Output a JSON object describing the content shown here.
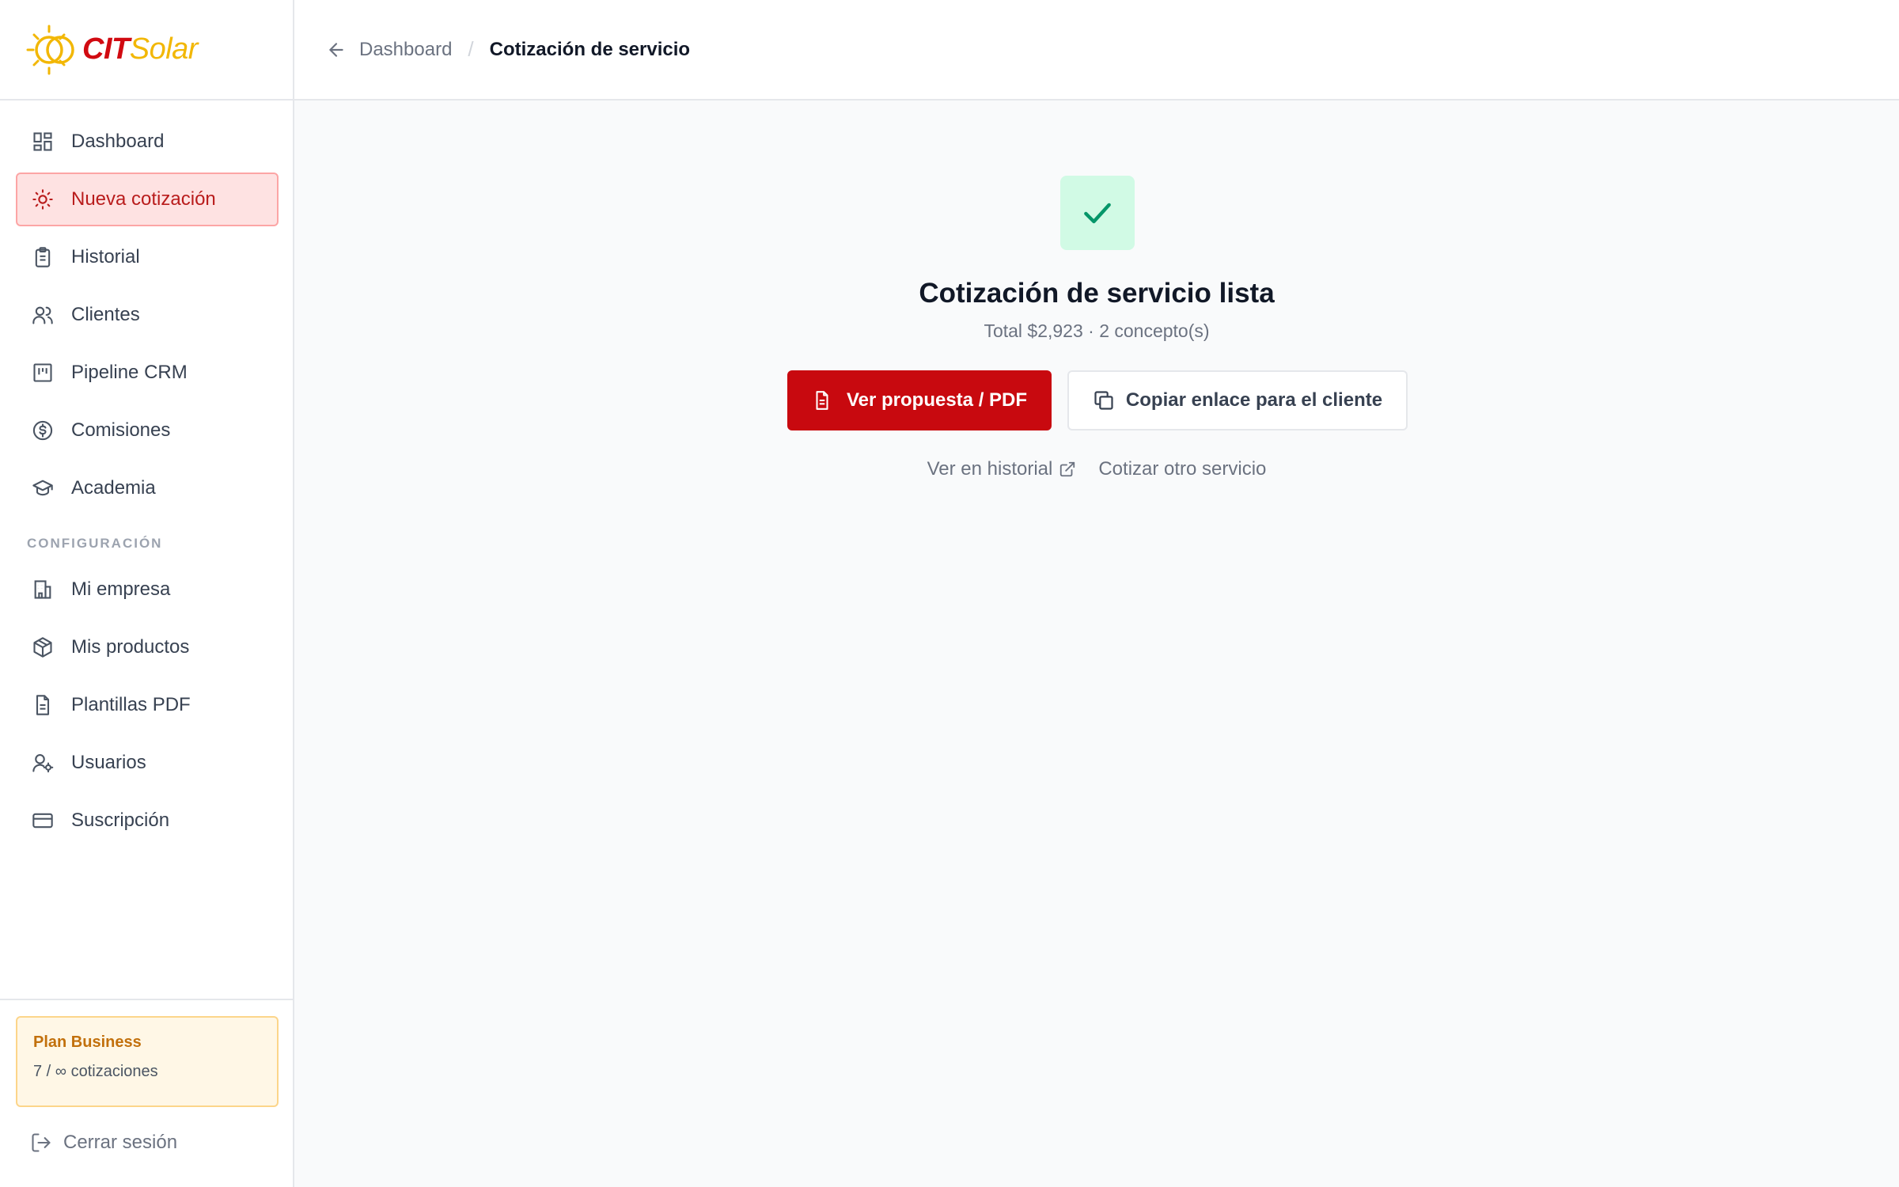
{
  "brand": {
    "part1": "CIT",
    "part2": "Solar",
    "primary_color": "#c8090f",
    "accent_color": "#f2b705"
  },
  "sidebar": {
    "items": [
      {
        "label": "Dashboard",
        "icon": "dashboard-icon"
      },
      {
        "label": "Nueva cotización",
        "icon": "sun-icon",
        "active": true
      },
      {
        "label": "Historial",
        "icon": "clipboard-icon"
      },
      {
        "label": "Clientes",
        "icon": "users-icon"
      },
      {
        "label": "Pipeline CRM",
        "icon": "kanban-icon"
      },
      {
        "label": "Comisiones",
        "icon": "dollar-circle-icon"
      },
      {
        "label": "Academia",
        "icon": "graduation-cap-icon"
      }
    ],
    "config_label": "CONFIGURACIÓN",
    "config_items": [
      {
        "label": "Mi empresa",
        "icon": "building-icon"
      },
      {
        "label": "Mis productos",
        "icon": "package-icon"
      },
      {
        "label": "Plantillas PDF",
        "icon": "file-text-icon"
      },
      {
        "label": "Usuarios",
        "icon": "user-cog-icon"
      },
      {
        "label": "Suscripción",
        "icon": "credit-card-icon"
      }
    ],
    "plan": {
      "title": "Plan Business",
      "usage": "7 / ∞ cotizaciones"
    },
    "logout_label": "Cerrar sesión"
  },
  "breadcrumb": {
    "back_label": "Dashboard",
    "separator": "/",
    "current": "Cotización de servicio"
  },
  "main": {
    "title": "Cotización de servicio lista",
    "subtitle": "Total $2,923 · 2 concepto(s)",
    "primary_button": "Ver propuesta / PDF",
    "secondary_button": "Copiar enlace para el cliente",
    "link_history": "Ver en historial",
    "link_new": "Cotizar otro servicio",
    "success_color": "#059669"
  }
}
